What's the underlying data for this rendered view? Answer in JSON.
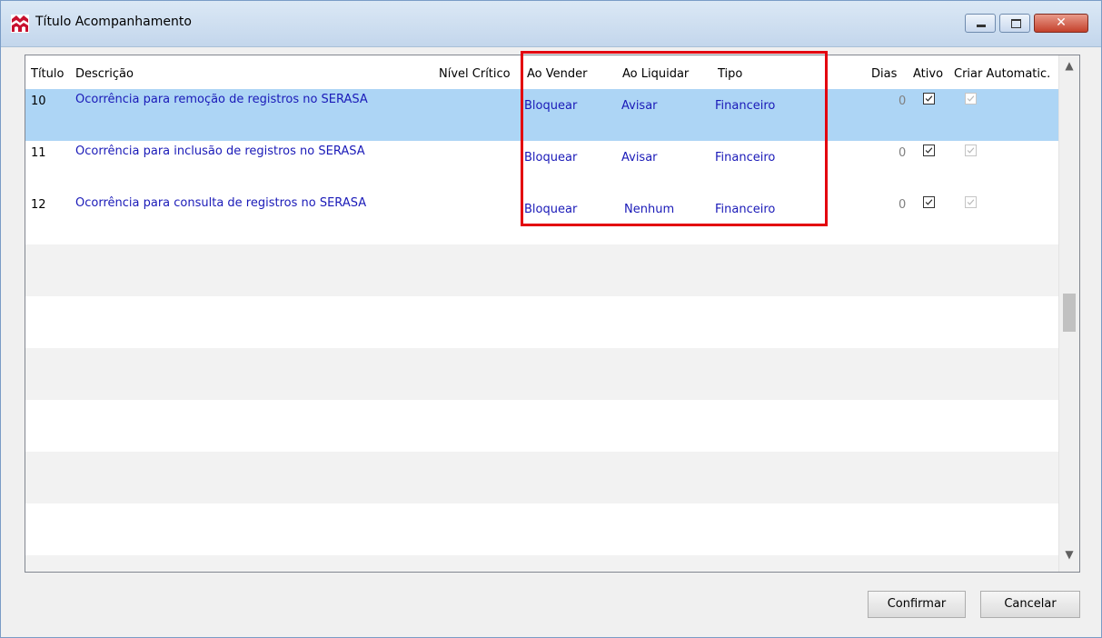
{
  "window": {
    "title": "Título Acompanhamento",
    "icon": "app-logo-icon",
    "controls": {
      "minimize": "minimize-icon",
      "maximize": "maximize-icon",
      "close": "✕"
    }
  },
  "grid": {
    "columns": {
      "titulo": "Título",
      "descricao": "Descrição",
      "nivel_critico": "Nível Crítico",
      "ao_vender": "Ao Vender",
      "ao_liquidar": "Ao Liquidar",
      "tipo": "Tipo",
      "dias": "Dias",
      "ativo": "Ativo",
      "criar_automatic": "Criar Automatic."
    },
    "rows": [
      {
        "titulo": "10",
        "descricao": "Ocorrência para remoção de registros no SERASA",
        "ao_vender": "Bloquear",
        "ao_liquidar": "Avisar",
        "tipo": "Financeiro",
        "dias": "0",
        "ativo": true,
        "criar_automatic": true
      },
      {
        "titulo": "11",
        "descricao": "Ocorrência para inclusão de registros no SERASA",
        "ao_vender": "Bloquear",
        "ao_liquidar": "Avisar",
        "tipo": "Financeiro",
        "dias": "0",
        "ativo": true,
        "criar_automatic": true
      },
      {
        "titulo": "12",
        "descricao": "Ocorrência para consulta de registros no SERASA",
        "ao_vender": "Bloquear",
        "ao_liquidar": "Nenhum",
        "tipo": "Financeiro",
        "dias": "0",
        "ativo": true,
        "criar_automatic": true
      }
    ],
    "scroll": {
      "up": "▲",
      "down": "▼"
    }
  },
  "buttons": {
    "confirm": "Confirmar",
    "cancel": "Cancelar"
  },
  "colors": {
    "highlight": "#e3000f",
    "selected_row": "#add5f5",
    "link_text": "#1a1ab8"
  }
}
